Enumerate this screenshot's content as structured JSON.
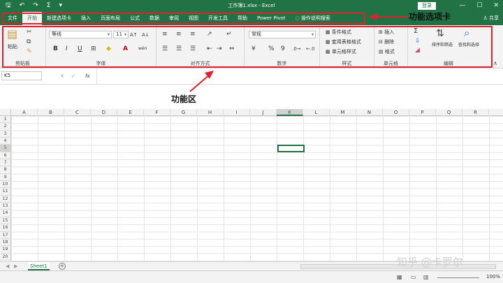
{
  "titlebar": {
    "title": "工作簿1.xlsx - Excel",
    "login": "登录",
    "qat_save": "🖫",
    "qat_undo": "↶",
    "qat_redo": "↷",
    "qat_sum": "Σ",
    "qat_more": "▾",
    "win_min": "—",
    "win_max": "☐",
    "win_close": "✕"
  },
  "tabs": [
    "文件",
    "开始",
    "新建选项卡",
    "插入",
    "页面布局",
    "公式",
    "数据",
    "审阅",
    "视图",
    "开发工具",
    "帮助",
    "Power Pivot",
    "操作说明搜索"
  ],
  "share": "共享",
  "ribbon": {
    "clipboard": {
      "label": "剪贴板",
      "paste": "粘贴"
    },
    "font": {
      "label": "字体",
      "name": "等线",
      "size": "11",
      "bold": "B",
      "italic": "I",
      "underline": "U",
      "grow": "A↑",
      "shrink": "A↓",
      "color": "A",
      "wen": "wén"
    },
    "alignment": {
      "label": "对齐方式"
    },
    "number": {
      "label": "数字",
      "format": "常规",
      "percent": "%",
      "comma": "9"
    },
    "styles": {
      "label": "样式",
      "cond": "条件格式",
      "table": "套用表格格式",
      "cell": "单元格样式"
    },
    "cells": {
      "label": "单元格",
      "insert": "插入",
      "delete": "删除",
      "format": "格式"
    },
    "editing": {
      "label": "编辑",
      "sum": "Σ",
      "sort": "排序和筛选",
      "find": "查找和选择"
    }
  },
  "formula_bar": {
    "name_box": "K5",
    "cancel": "✕",
    "enter": "✓",
    "fx": "fx"
  },
  "columns": [
    "A",
    "B",
    "C",
    "D",
    "E",
    "F",
    "G",
    "H",
    "I",
    "J",
    "K",
    "L",
    "M",
    "N",
    "O",
    "P",
    "Q",
    "R"
  ],
  "rows": [
    "1",
    "2",
    "3",
    "4",
    "5",
    "6",
    "7",
    "8",
    "9",
    "10",
    "11",
    "12",
    "13",
    "14",
    "15",
    "16",
    "17",
    "18",
    "19",
    "20"
  ],
  "selected_cell": "K5",
  "sheet": {
    "tab": "Sheet1",
    "add": "+"
  },
  "status": {
    "zoom": "100%"
  },
  "annotations": {
    "tab_label": "功能选项卡",
    "ribbon_label": "功能区"
  },
  "watermark": "知乎 @卡罗尔"
}
